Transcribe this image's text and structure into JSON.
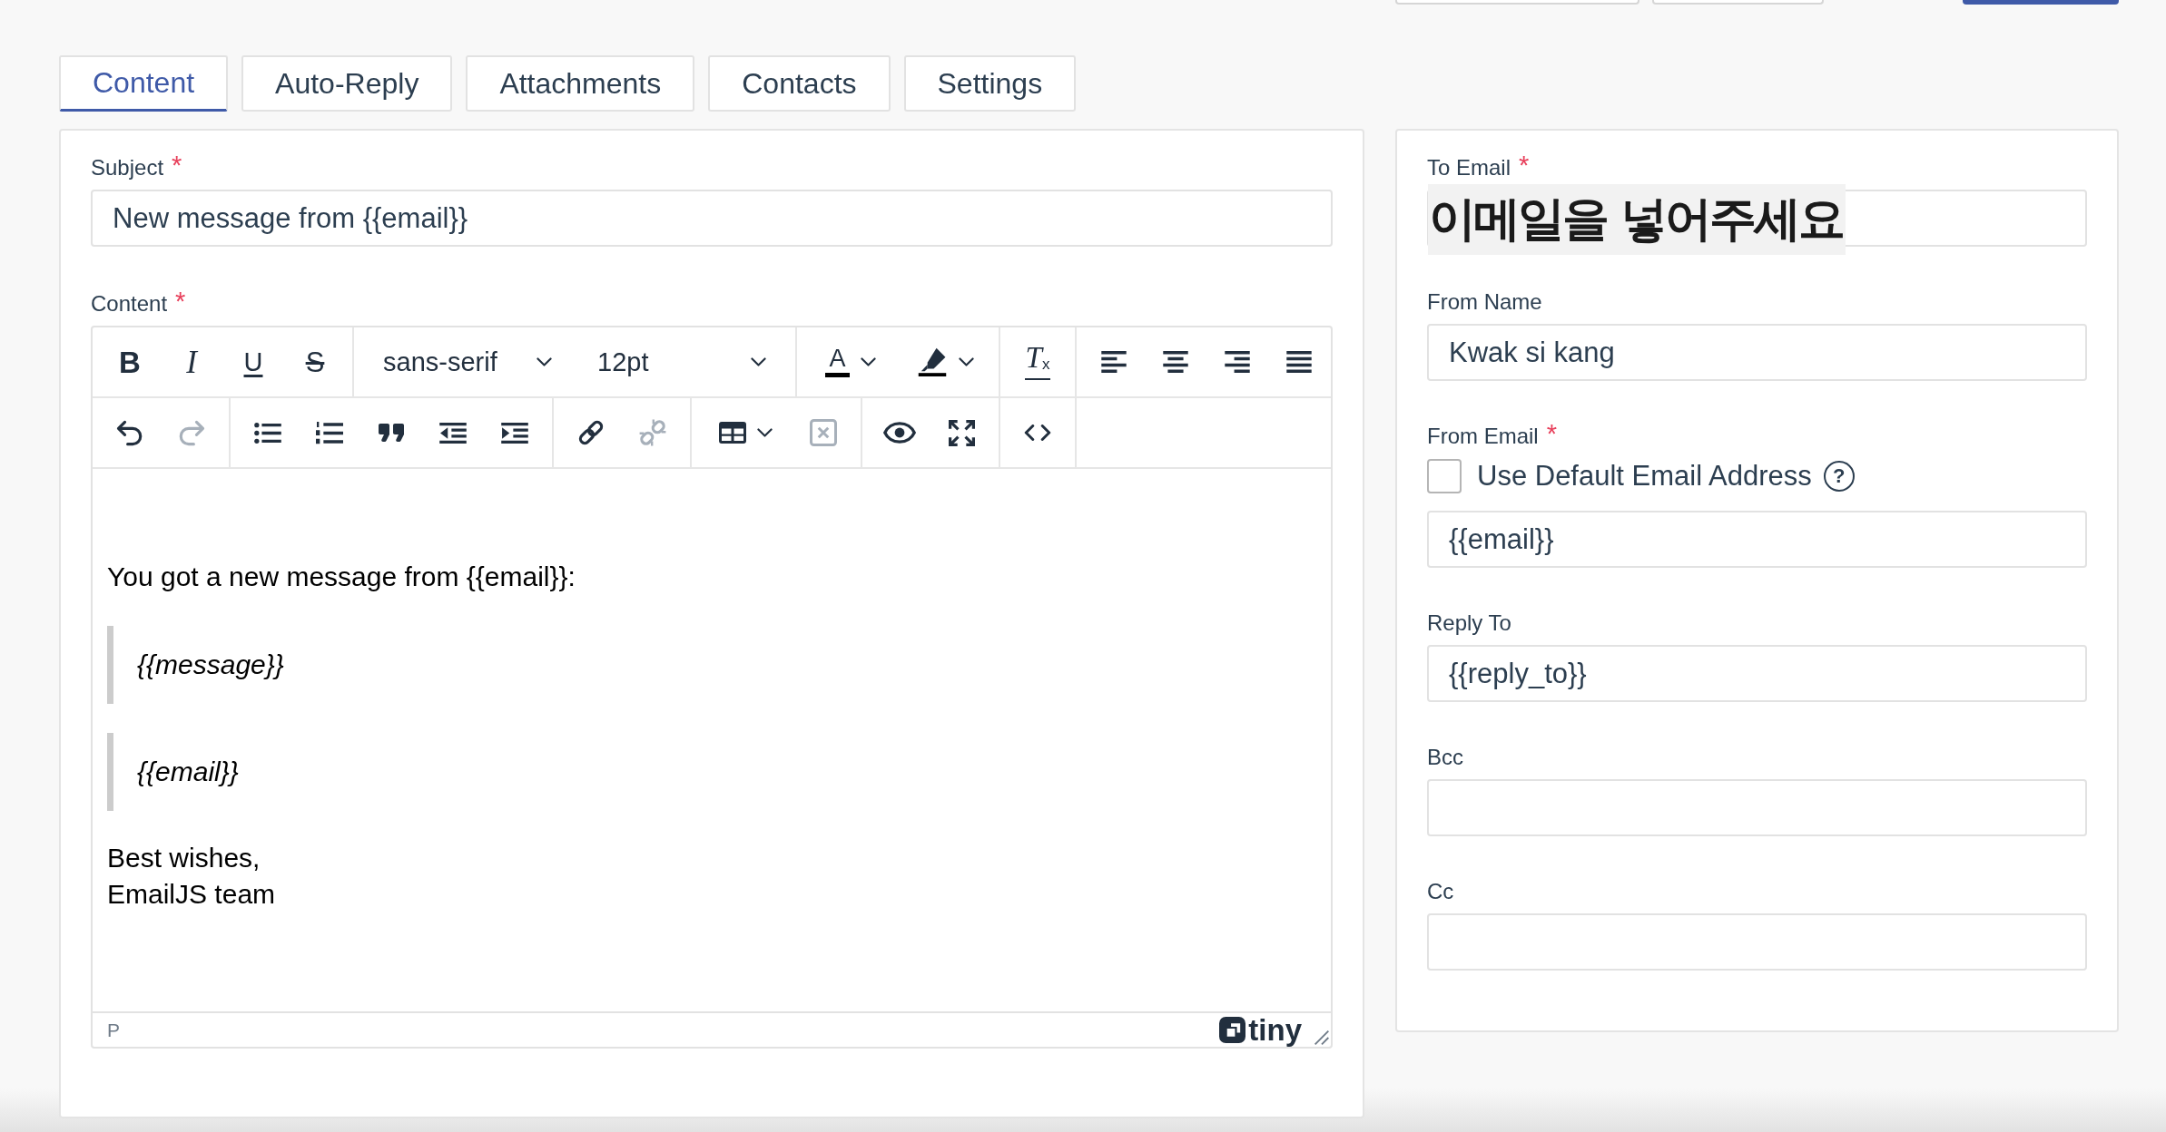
{
  "header_buttons": [
    {
      "kind": "outline"
    },
    {
      "kind": "outline"
    },
    {
      "kind": "primary"
    }
  ],
  "tabs": [
    {
      "label": "Content",
      "selected": true
    },
    {
      "label": "Auto-Reply",
      "selected": false
    },
    {
      "label": "Attachments",
      "selected": false
    },
    {
      "label": "Contacts",
      "selected": false
    },
    {
      "label": "Settings",
      "selected": false
    }
  ],
  "content_panel": {
    "subject": {
      "label": "Subject",
      "required_mark": "*",
      "value": "New message from {{email}}"
    },
    "content": {
      "label": "Content",
      "required_mark": "*"
    },
    "editor": {
      "toolbar": [
        {
          "groups": [
            {
              "items": [
                {
                  "kind": "bold",
                  "glyph": "B",
                  "disabled": false
                },
                {
                  "kind": "italic",
                  "glyph": "I",
                  "disabled": false
                },
                {
                  "kind": "underline",
                  "glyph": "U",
                  "disabled": false
                },
                {
                  "kind": "strike",
                  "glyph": "S",
                  "disabled": false
                }
              ]
            },
            {
              "items": [
                {
                  "kind": "select",
                  "value": "sans-serif",
                  "disabled": false
                },
                {
                  "kind": "select",
                  "value": "12pt",
                  "disabled": false
                }
              ]
            },
            {
              "items": [
                {
                  "kind": "forecolor",
                  "glyph": "A",
                  "disabled": false
                },
                {
                  "kind": "backcolor",
                  "disabled": false
                }
              ]
            },
            {
              "items": [
                {
                  "kind": "clearformat",
                  "glyph": "T$_{x}$",
                  "disabled": false
                }
              ]
            },
            {
              "items": [
                {
                  "kind": "alignleft",
                  "disabled": false
                },
                {
                  "kind": "aligncenter",
                  "disabled": false
                },
                {
                  "kind": "alignright",
                  "disabled": false
                },
                {
                  "kind": "justify",
                  "disabled": false
                }
              ]
            }
          ]
        },
        {
          "groups": [
            {
              "items": [
                {
                  "kind": "undo",
                  "disabled": false
                },
                {
                  "kind": "redo",
                  "disabled": true
                }
              ]
            },
            {
              "items": [
                {
                  "kind": "bullist",
                  "disabled": false
                },
                {
                  "kind": "numlist",
                  "disabled": false
                },
                {
                  "kind": "blockquote",
                  "disabled": false
                },
                {
                  "kind": "outdent",
                  "disabled": false
                },
                {
                  "kind": "indent",
                  "disabled": false
                }
              ]
            },
            {
              "items": [
                {
                  "kind": "link",
                  "disabled": false
                },
                {
                  "kind": "unlink",
                  "disabled": true
                }
              ]
            },
            {
              "items": [
                {
                  "kind": "table",
                  "disabled": false
                },
                {
                  "kind": "deletetable",
                  "disabled": true
                }
              ]
            },
            {
              "items": [
                {
                  "kind": "preview",
                  "disabled": false
                },
                {
                  "kind": "fullscreen",
                  "disabled": false
                }
              ]
            },
            {
              "items": [
                {
                  "kind": "code",
                  "disabled": false
                }
              ]
            }
          ]
        }
      ],
      "body": [
        {
          "kind": "paragraph",
          "lines": [
            "You got a new message from {{email}}:"
          ]
        },
        {
          "kind": "quote",
          "lines": [
            "{{message}}"
          ]
        },
        {
          "kind": "quote",
          "lines": [
            "{{email}}"
          ]
        },
        {
          "kind": "paragraph",
          "lines": [
            "Best wishes,",
            "EmailJS team"
          ]
        }
      ],
      "status_path": "P",
      "branding": "tiny"
    }
  },
  "settings_panel": {
    "fields": [
      {
        "label": "To Email",
        "required_mark": "*",
        "annotation": "이메일을 넣어주세요"
      },
      {
        "label": "From Name",
        "value": "Kwak si kang"
      },
      {
        "label": "From Email",
        "required_mark": "*",
        "checkbox": {
          "label": "Use Default Email Address",
          "checked": false,
          "help": "?"
        },
        "value": "{{email}}"
      },
      {
        "label": "Reply To",
        "value": "{{reply_to}}"
      },
      {
        "label": "Bcc"
      },
      {
        "label": "Cc"
      }
    ]
  }
}
